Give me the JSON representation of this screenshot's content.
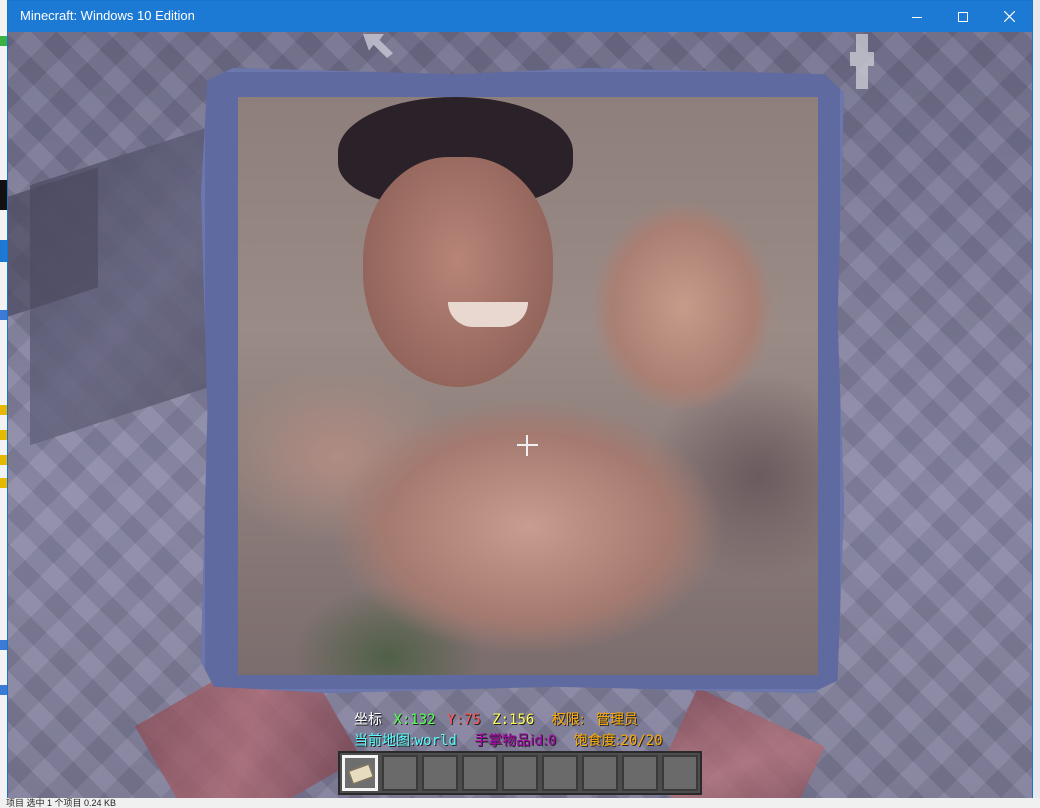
{
  "window": {
    "title": "Minecraft: Windows 10 Edition",
    "accent_color": "#1c7ad4",
    "controls": [
      "minimize-icon",
      "maximize-icon",
      "close-icon"
    ]
  },
  "hud": {
    "coords_label": "坐标",
    "x_label": "X:",
    "x_value": "132",
    "y_label": "Y:",
    "y_value": "75",
    "z_label": "Z:",
    "z_value": "156",
    "permission_label": "权限:",
    "permission_value": "管理员",
    "map_label": "当前地图:",
    "map_value": "world",
    "held_item_label": "手掌物品id:",
    "held_item_value": "0",
    "saturation_label": "饱食度:",
    "saturation_value": "20/20",
    "colors": {
      "white": "#ffffff",
      "x_green": "#55ff55",
      "y_red": "#ff5555",
      "z_yellow": "#ffff55",
      "gold": "#ffaa00",
      "aqua": "#55ffff",
      "purple": "#aa00aa"
    }
  },
  "hotbar": {
    "slot_count": 9,
    "selected_slot": 0,
    "selected_item_icon": "map-item-icon"
  },
  "desktop": {
    "status_text": "项目   选中 1 个项目  0.24 KB"
  }
}
